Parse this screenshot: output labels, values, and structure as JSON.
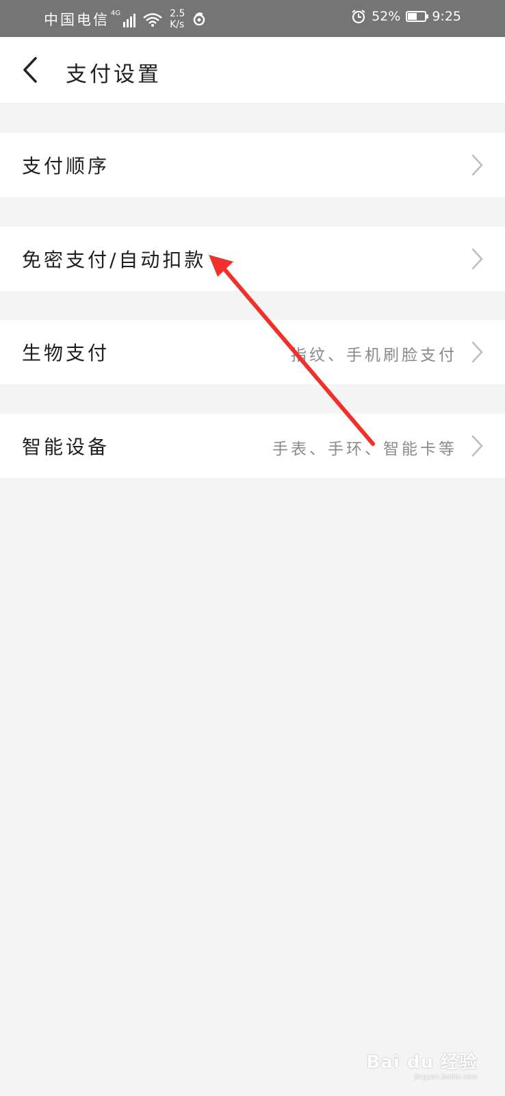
{
  "status_bar": {
    "carrier": "中国电信",
    "network": "4G",
    "speed_value": "2.5",
    "speed_unit": "K/s",
    "battery": "52%",
    "battery_level": 0.52,
    "time": "9:25"
  },
  "nav": {
    "title": "支付设置",
    "back_icon": "chevron-left-icon"
  },
  "rows": [
    {
      "label": "支付顺序",
      "value": ""
    },
    {
      "label": "免密支付/自动扣款",
      "value": ""
    },
    {
      "label": "生物支付",
      "value": "指纹、手机刷脸支付"
    },
    {
      "label": "智能设备",
      "value": "手表、手环、智能卡等"
    }
  ],
  "watermark": {
    "brand": "Bai du 经验",
    "domain": "jingyan.baidu.com"
  },
  "colors": {
    "arrow": "#f0302a",
    "status_bar": "#757575",
    "background": "#f4f4f4"
  }
}
